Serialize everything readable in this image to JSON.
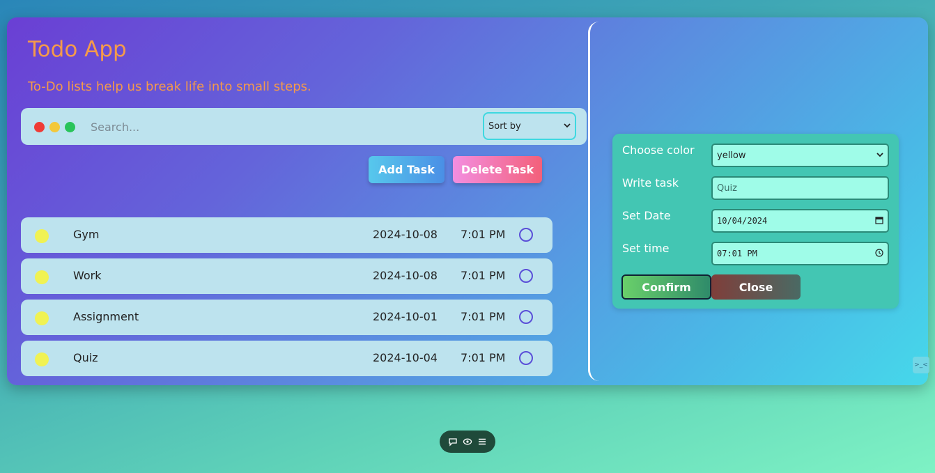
{
  "app": {
    "title": "Todo App",
    "subtitle": "To-Do lists help us break life into small steps."
  },
  "toolbar": {
    "search_placeholder": "Search...",
    "sort_label": "Sort by"
  },
  "actions": {
    "add_label": "Add Task",
    "delete_label": "Delete Task"
  },
  "tasks": [
    {
      "name": "Gym",
      "date": "2024-10-08",
      "time": "7:01 PM",
      "color": "#f0f253"
    },
    {
      "name": "Work",
      "date": "2024-10-08",
      "time": "7:01 PM",
      "color": "#f0f253"
    },
    {
      "name": "Assignment",
      "date": "2024-10-01",
      "time": "7:01 PM",
      "color": "#f0f253"
    },
    {
      "name": "Quiz",
      "date": "2024-10-04",
      "time": "7:01 PM",
      "color": "#f0f253"
    }
  ],
  "form": {
    "color_label": "Choose color",
    "color_value": "yellow",
    "task_label": "Write task",
    "task_value": "Quiz",
    "date_label": "Set Date",
    "date_value": "10/04/2024",
    "time_label": "Set time",
    "time_value": "07:01 PM",
    "confirm_label": "Confirm",
    "close_label": "Close"
  },
  "colors": {
    "accent_title": "#f59a4a",
    "dot_red": "#ef3b35",
    "dot_yellow": "#f3c83a",
    "dot_green": "#29c45a"
  },
  "icons": {
    "corner": "face-icon",
    "pill": [
      "comment-icon",
      "eye-icon",
      "menu-icon"
    ]
  }
}
